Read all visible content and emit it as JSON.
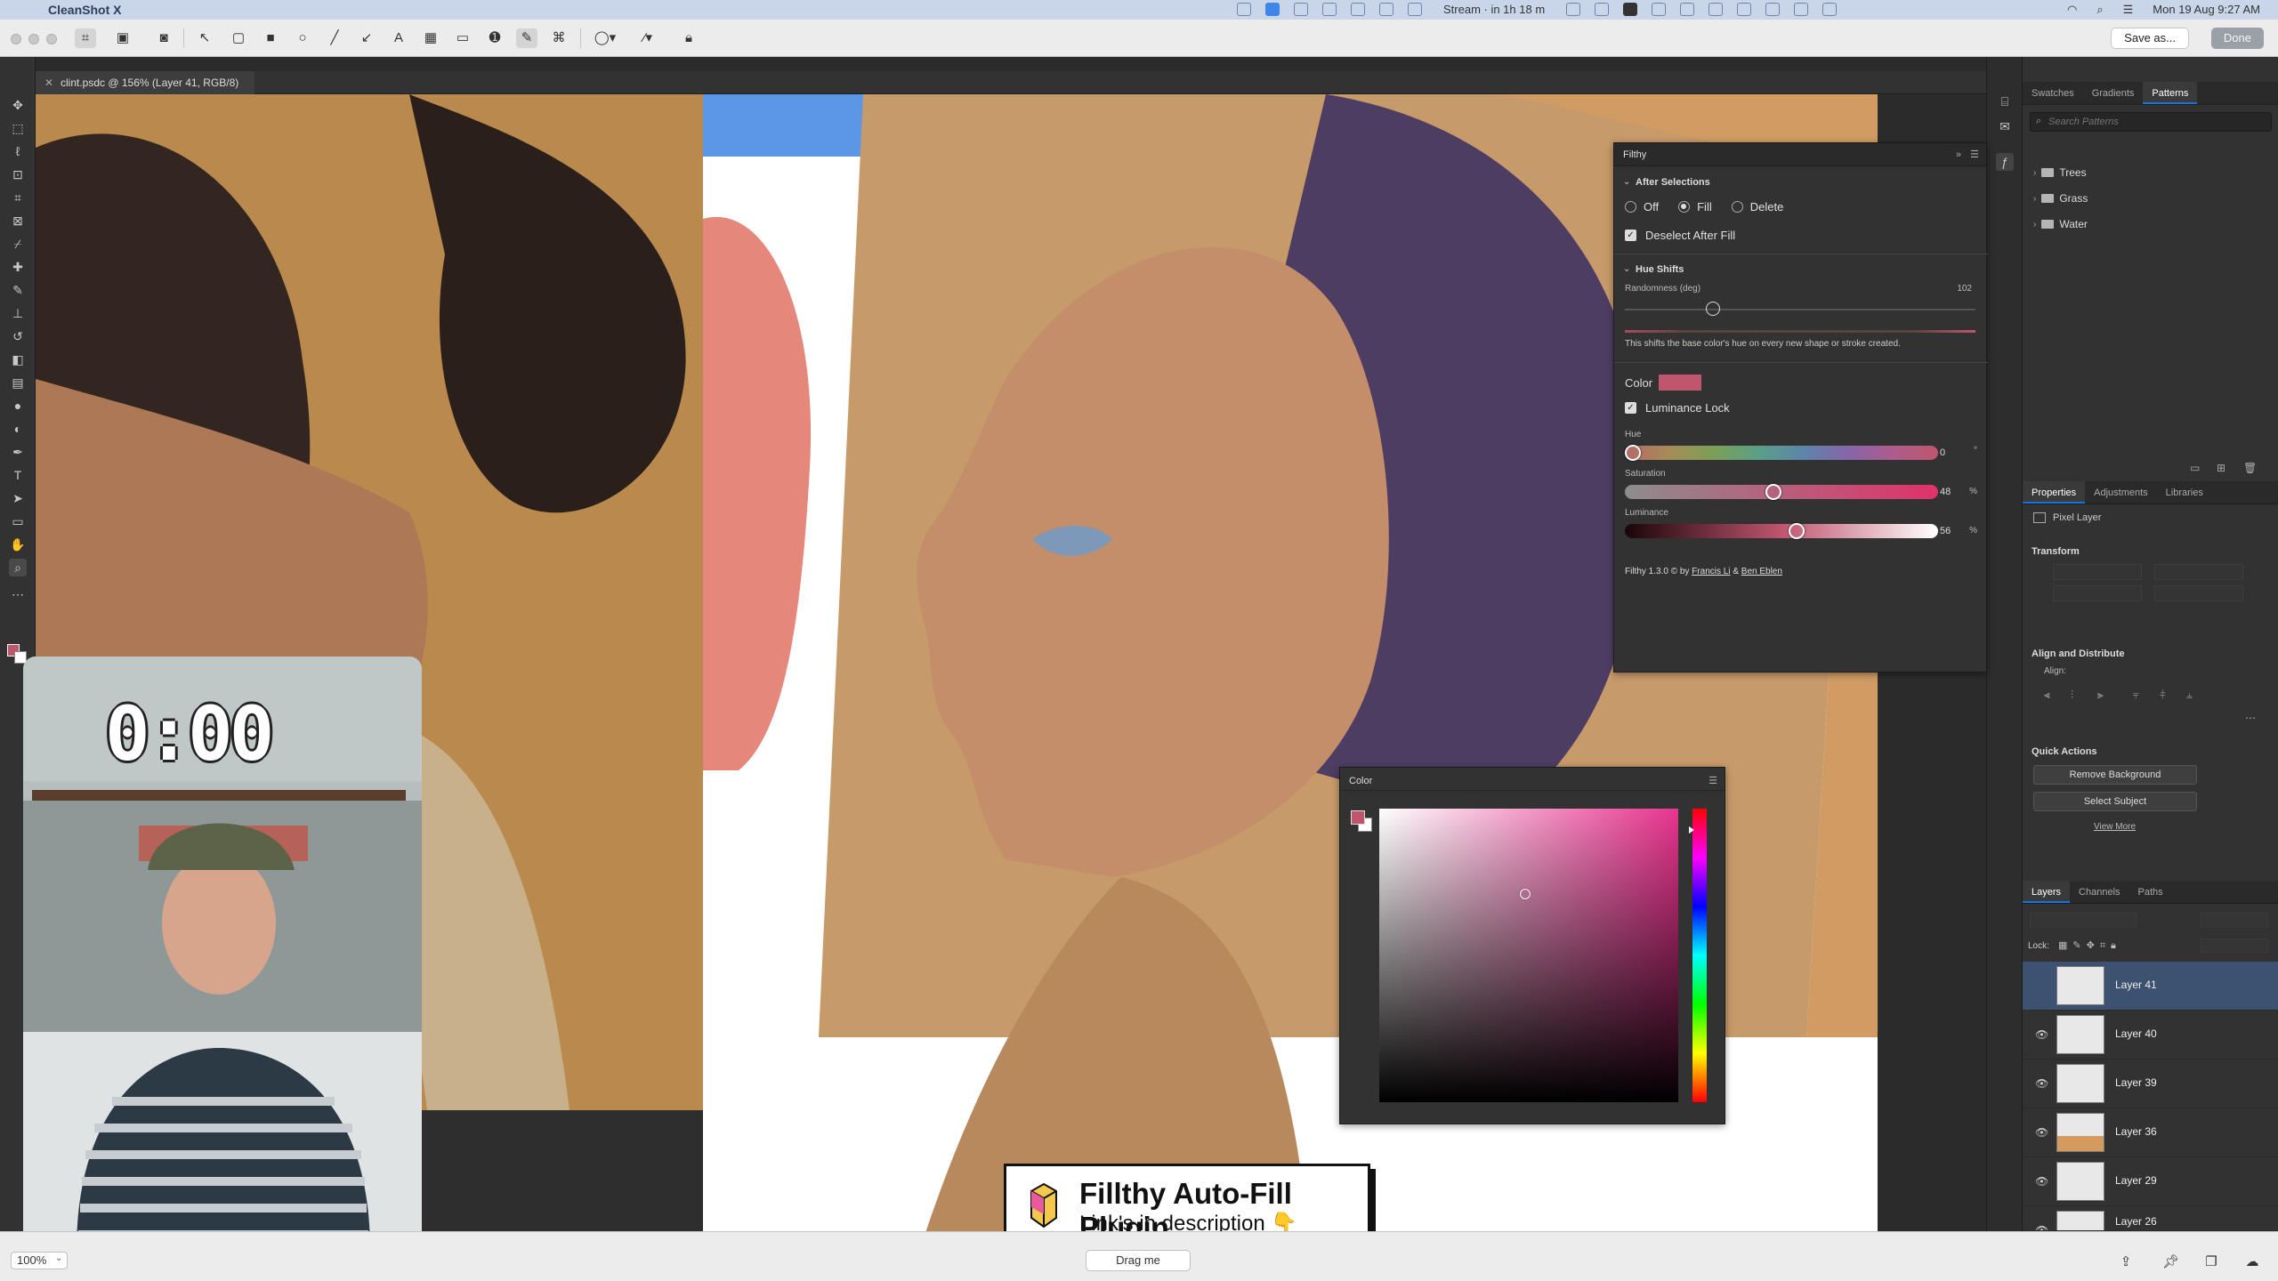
{
  "menubar": {
    "app_name": "CleanShot X",
    "stream_status": "Stream · in 1h 18 m",
    "datetime": "Mon 19 Aug  9:27 AM"
  },
  "toolbar": {
    "save_as_label": "Save as...",
    "done_label": "Done"
  },
  "document": {
    "tab_title": "clint.psdc @ 156% (Layer 41, RGB/8)"
  },
  "filthy": {
    "panel_title": "Filthy",
    "after_selections": {
      "heading": "After Selections",
      "options": [
        "Off",
        "Fill",
        "Delete"
      ],
      "selected": "Fill",
      "deselect_label": "Deselect After Fill"
    },
    "hue_shifts": {
      "heading": "Hue Shifts",
      "randomness_label": "Randomness (deg)",
      "randomness_value": "102",
      "randomness_fraction": 0.25,
      "description": "This shifts the base color's hue on every new shape or stroke created."
    },
    "color": {
      "label": "Color",
      "swatch": "#c0556e",
      "luminance_lock_label": "Luminance Lock",
      "hue_label": "Hue",
      "hue_value": "0",
      "saturation_label": "Saturation",
      "saturation_value": "48",
      "luminance_label": "Luminance",
      "luminance_value": "56"
    },
    "credits_prefix": "Filthy 1.3.0 © by ",
    "author1": "Francis Li",
    "credits_and": " & ",
    "author2": "Ben Eblen"
  },
  "color_panel": {
    "title": "Color"
  },
  "right_panels": {
    "top_tabs": [
      "Swatches",
      "Gradients",
      "Patterns"
    ],
    "search_placeholder": "Search Patterns",
    "pattern_folders": [
      "Trees",
      "Grass",
      "Water"
    ],
    "mid_tabs": [
      "Properties",
      "Adjustments",
      "Libraries"
    ],
    "pixel_layer_label": "Pixel Layer",
    "transform_heading": "Transform",
    "align_heading": "Align and Distribute",
    "align_label": "Align:",
    "quick_actions_heading": "Quick Actions",
    "remove_bg_label": "Remove Background",
    "select_subject_label": "Select Subject",
    "view_more_label": "View More",
    "layer_tabs": [
      "Layers",
      "Channels",
      "Paths"
    ],
    "lock_label": "Lock:",
    "layers": [
      "Layer 41",
      "Layer 40",
      "Layer 39",
      "Layer 36",
      "Layer 29",
      "Layer 26"
    ]
  },
  "webcam": {
    "timer": "0:00"
  },
  "banner": {
    "title": "Fillthy Auto-Fill Plugin",
    "subtitle": "Link's in description 👇"
  },
  "statusbar": {
    "zoom": "100%",
    "drag_label": "Drag me"
  },
  "colors": {
    "accent_blue": "#1473e6",
    "fg_color": "#c0556e"
  }
}
